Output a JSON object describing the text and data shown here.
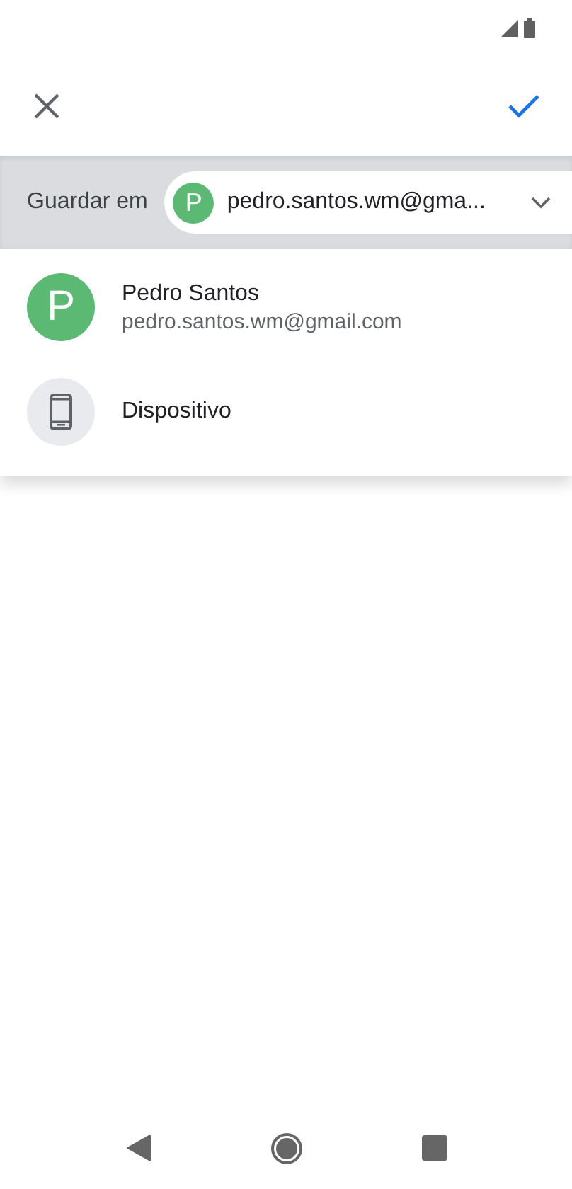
{
  "save_bar": {
    "label": "Guardar em",
    "account_selector": {
      "avatar_letter": "P",
      "text": "pedro.santos.wm@gma..."
    }
  },
  "menu": {
    "items": [
      {
        "kind": "account",
        "avatar_letter": "P",
        "name": "Pedro Santos",
        "email": "pedro.santos.wm@gmail.com"
      },
      {
        "kind": "device",
        "name": "Dispositivo"
      }
    ]
  }
}
